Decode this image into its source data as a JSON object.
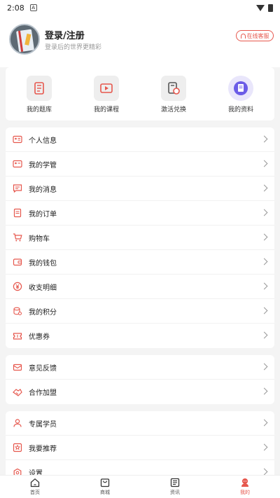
{
  "status_bar": {
    "time": "2:08",
    "notif": "A"
  },
  "header": {
    "login_title": "登录/注册",
    "login_subtitle": "登录后的世界更精彩",
    "service_label": "在线客服"
  },
  "quick_actions": [
    {
      "label": "我的题库",
      "icon": "question-bank-icon"
    },
    {
      "label": "我的课程",
      "icon": "course-play-icon"
    },
    {
      "label": "激活兑换",
      "icon": "redeem-icon"
    },
    {
      "label": "我的资料",
      "icon": "document-icon"
    }
  ],
  "menu_groups": [
    [
      {
        "label": "个人信息",
        "icon": "id-card-icon"
      },
      {
        "label": "我的学管",
        "icon": "advisor-card-icon"
      },
      {
        "label": "我的消息",
        "icon": "message-icon"
      },
      {
        "label": "我的订单",
        "icon": "order-icon"
      },
      {
        "label": "购物车",
        "icon": "cart-icon"
      },
      {
        "label": "我的钱包",
        "icon": "wallet-icon"
      },
      {
        "label": "收支明细",
        "icon": "yen-icon"
      },
      {
        "label": "我的积分",
        "icon": "points-icon"
      },
      {
        "label": "优惠券",
        "icon": "coupon-icon"
      }
    ],
    [
      {
        "label": "意见反馈",
        "icon": "feedback-icon"
      },
      {
        "label": "合作加盟",
        "icon": "partnership-icon"
      }
    ],
    [
      {
        "label": "专属学员",
        "icon": "student-icon"
      },
      {
        "label": "我要推荐",
        "icon": "recommend-icon"
      },
      {
        "label": "设置",
        "icon": "settings-icon"
      }
    ]
  ],
  "tabbar": [
    {
      "label": "首页",
      "icon": "home-icon",
      "active": false
    },
    {
      "label": "商城",
      "icon": "shop-bag-icon",
      "active": false
    },
    {
      "label": "资讯",
      "icon": "news-icon",
      "active": false
    },
    {
      "label": "我的",
      "icon": "profile-icon",
      "active": true
    }
  ],
  "colors": {
    "accent": "#e6574d",
    "background": "#f4f4f4"
  }
}
